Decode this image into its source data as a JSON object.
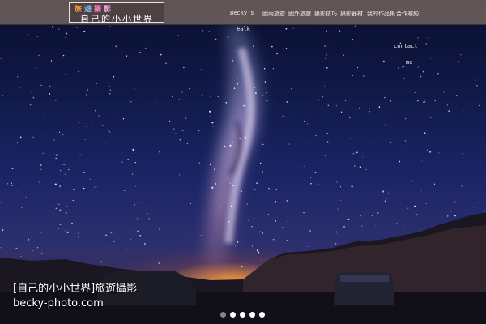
{
  "logo": {
    "line1": [
      "旅",
      "遊",
      "攝",
      "影"
    ],
    "line2": "自己的小小世界"
  },
  "nav": {
    "items": [
      {
        "label": "Becky's",
        "id": "beckys"
      },
      {
        "label": "talk",
        "id": "talk"
      },
      {
        "label": "國內旅遊",
        "id": "domestic"
      },
      {
        "label": "國外旅遊",
        "id": "overseas"
      },
      {
        "label": "攝影技巧",
        "id": "photo-tips"
      },
      {
        "label": "攝影器材",
        "id": "photo-gear"
      },
      {
        "label": "我的作品集",
        "id": "portfolio"
      },
      {
        "label": "合作邀約",
        "id": "cooperation"
      },
      {
        "label": "contact",
        "id": "contact"
      },
      {
        "label": "me",
        "id": "me"
      }
    ]
  },
  "caption": {
    "title": "[自己的小小世界]旅遊攝影",
    "url": "becky-photo.com"
  },
  "slider": {
    "count": 5,
    "active_index": 0
  },
  "colors": {
    "topbar": "#6e5f5a",
    "nav_text": "#f2ece4",
    "sky": "#101a4a",
    "horizon_glow": "#ffa03c"
  }
}
